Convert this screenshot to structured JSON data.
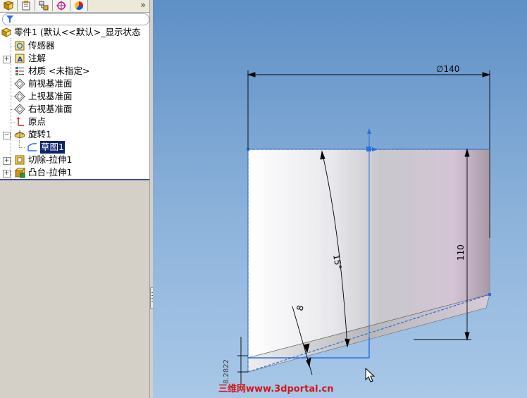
{
  "feature_tree": {
    "items": [
      {
        "label": "零件1 (默认<<默认>_显示状态",
        "icon": "part-icon"
      },
      {
        "label": "传感器",
        "icon": "sensor-icon"
      },
      {
        "label": "注解",
        "icon": "annotation-icon"
      },
      {
        "label": "材质 <未指定>",
        "icon": "material-icon"
      },
      {
        "label": "前视基准面",
        "icon": "plane-icon"
      },
      {
        "label": "上视基准面",
        "icon": "plane-icon"
      },
      {
        "label": "右视基准面",
        "icon": "plane-icon"
      },
      {
        "label": "原点",
        "icon": "origin-icon"
      },
      {
        "label": "旋转1",
        "icon": "revolve-icon"
      },
      {
        "label": "草图1",
        "icon": "sketch-icon",
        "selected": true
      },
      {
        "label": "切除-拉伸1",
        "icon": "cut-extrude-icon"
      },
      {
        "label": "凸台-拉伸1",
        "icon": "boss-extrude-icon"
      }
    ],
    "more_label": "»"
  },
  "dimensions": {
    "diameter": "∅140",
    "height": "110",
    "angle": "15°",
    "offset": "8",
    "small_left": "8.2822"
  },
  "watermark": "三维网www.3dportal.cn",
  "colors": {
    "selection": "#0a246a",
    "sketch": "#2a6fe0",
    "watermark": "#d01818"
  }
}
